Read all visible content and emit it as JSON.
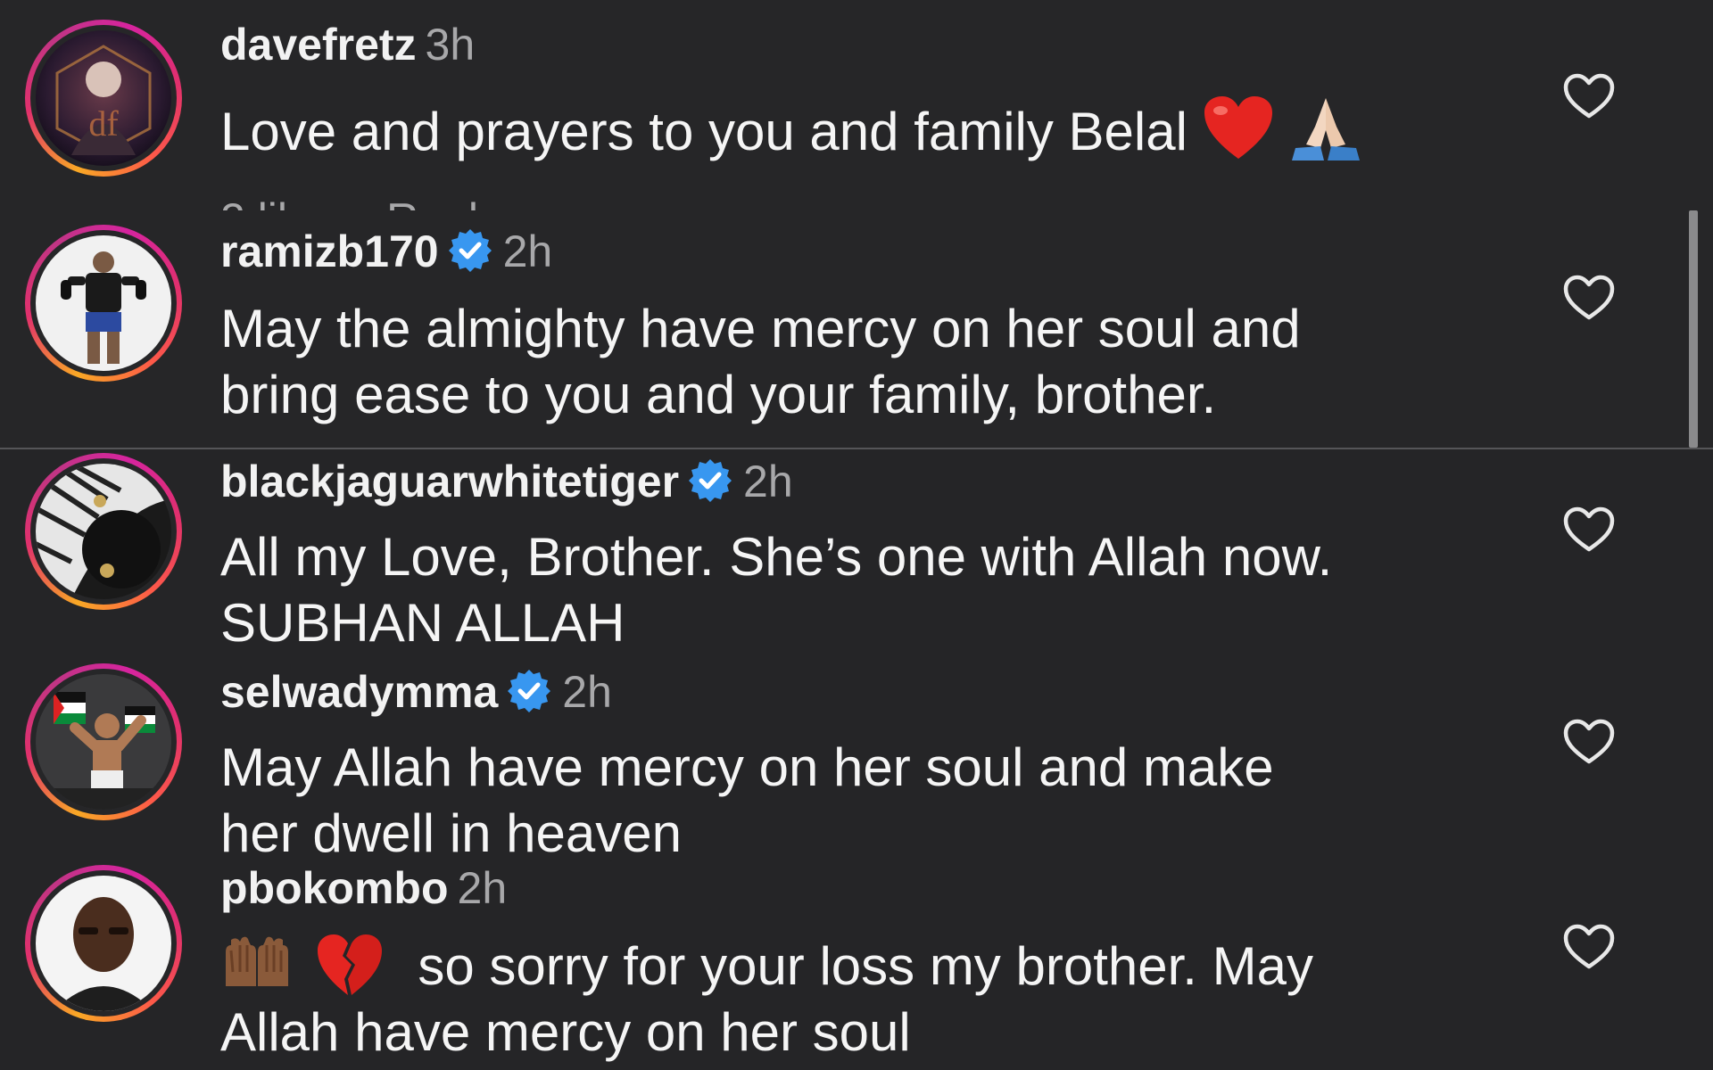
{
  "comments": [
    {
      "username": "davefretz",
      "time": "3h",
      "verified": false,
      "text_lines": [
        "Love and prayers to you and family Belal"
      ],
      "emojis": [
        "red-heart",
        "folded-hands"
      ]
    },
    {
      "username": "ramizb170",
      "time": "2h",
      "verified": true,
      "text_lines": [
        "May the almighty have mercy on her soul and",
        "bring ease to you and your family, brother."
      ]
    },
    {
      "username": "blackjaguarwhitetiger",
      "time": "2h",
      "verified": true,
      "text_lines": [
        "All my Love, Brother. She’s one with Allah now.",
        "SUBHAN ALLAH"
      ]
    },
    {
      "username": "selwadymma",
      "time": "2h",
      "verified": true,
      "text_lines": [
        "May Allah have mercy on her soul and make",
        "her dwell in heaven"
      ]
    },
    {
      "username": "pbokombo",
      "time": "2h",
      "verified": false,
      "text_lines": [
        "so sorry for your loss my brother. May",
        "Allah have mercy on her soul"
      ],
      "emojis": [
        "raised-hands",
        "broken-heart"
      ]
    }
  ],
  "colors": {
    "background": "#252527",
    "text": "#f5f5f5",
    "secondary_text": "#a8a8aa",
    "verified_badge": "#3897f0",
    "story_ring": [
      "#f9a825",
      "#e1306c",
      "#c13584"
    ]
  },
  "icons": [
    "heart-outline-icon",
    "verified-badge-icon"
  ]
}
